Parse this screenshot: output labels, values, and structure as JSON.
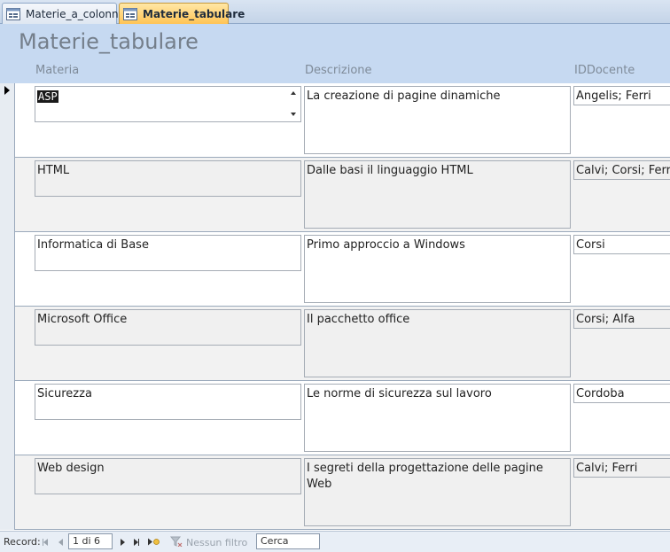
{
  "tabs": [
    {
      "label": "Materie_a_colonne",
      "active": false
    },
    {
      "label": "Materie_tabulare",
      "active": true
    }
  ],
  "form": {
    "title": "Materie_tabulare",
    "columns": {
      "materia": "Materia",
      "descrizione": "Descrizione",
      "iddocente": "IDDocente"
    }
  },
  "records": [
    {
      "materia": "ASP",
      "descrizione": "La creazione di pagine dinamiche",
      "iddocente": "Angelis; Ferri"
    },
    {
      "materia": "HTML",
      "descrizione": "Dalle basi il linguaggio HTML",
      "iddocente": "Calvi; Corsi; Ferri"
    },
    {
      "materia": "Informatica di Base",
      "descrizione": "Primo approccio a Windows",
      "iddocente": "Corsi"
    },
    {
      "materia": "Microsoft Office",
      "descrizione": "Il pacchetto office",
      "iddocente": "Corsi; Alfa"
    },
    {
      "materia": "Sicurezza",
      "descrizione": "Le norme di sicurezza sul lavoro",
      "iddocente": "Cordoba"
    },
    {
      "materia": "Web design",
      "descrizione": "I segreti della progettazione delle pagine Web",
      "iddocente": "Calvi; Ferri"
    }
  ],
  "navigator": {
    "label": "Record:",
    "current": "1 di 6",
    "filter": "Nessun filtro",
    "search": "Cerca"
  },
  "colors": {
    "header": "#c6d9f1",
    "active_tab": "#ffc454",
    "alt_row": "#f2f2f2"
  }
}
